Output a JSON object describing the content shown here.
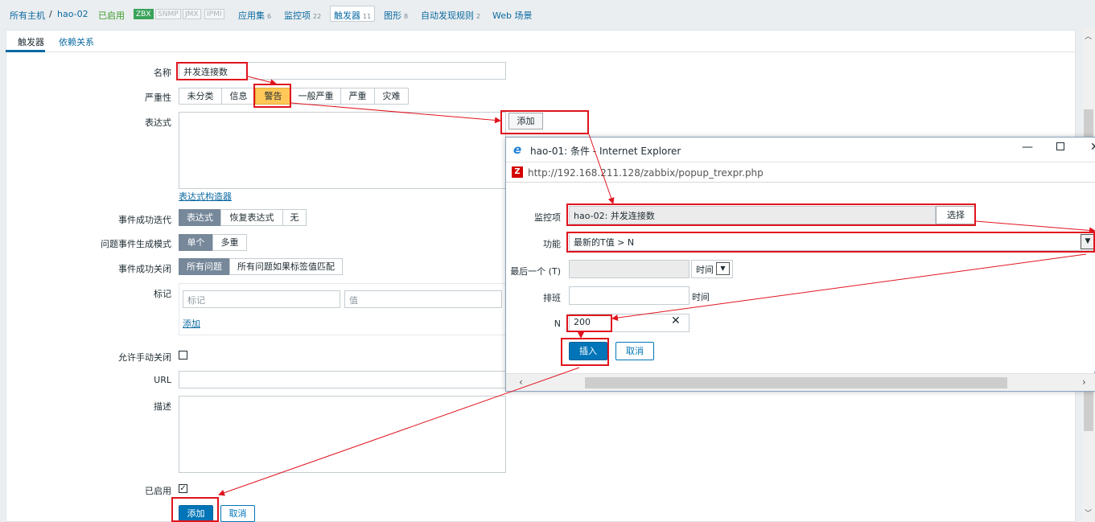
{
  "nav": {
    "all_hosts": "所有主机",
    "sep": "/",
    "host": "hao-02",
    "enabled": "已启用",
    "tags": [
      "ZBX",
      "SNMP",
      "JMX",
      "IPMI"
    ],
    "items": [
      {
        "label": "应用集",
        "count": "6"
      },
      {
        "label": "监控项",
        "count": "22"
      },
      {
        "label": "触发器",
        "count": "11"
      },
      {
        "label": "图形",
        "count": "8"
      },
      {
        "label": "自动发现规则",
        "count": "2"
      },
      {
        "label": "Web 场景",
        "count": ""
      }
    ]
  },
  "subtabs": [
    "触发器",
    "依赖关系"
  ],
  "form": {
    "name_label": "名称",
    "name_value": "并发连接数",
    "severity_label": "严重性",
    "severities": [
      "未分类",
      "信息",
      "警告",
      "一般严重",
      "严重",
      "灾难"
    ],
    "expression_label": "表达式",
    "add_button": "添加",
    "expr_builder": "表达式构造器",
    "ok_event_label": "事件成功迭代",
    "ok_event_options": [
      "表达式",
      "恢复表达式",
      "无"
    ],
    "problem_mode_label": "问题事件生成模式",
    "problem_mode_options": [
      "单个",
      "多重"
    ],
    "ok_close_label": "事件成功关闭",
    "ok_close_options": [
      "所有问题",
      "所有问题如果标签值匹配"
    ],
    "tags_label": "标记",
    "tag_placeholder": "标记",
    "value_placeholder": "值",
    "tag_add": "添加",
    "manual_close_label": "允许手动关闭",
    "url_label": "URL",
    "desc_label": "描述",
    "enabled_label": "已启用",
    "submit": "添加",
    "cancel": "取消"
  },
  "popup": {
    "title": "hao-01: 条件 - Internet Explorer",
    "address": "http://192.168.211.128/zabbix/popup_trexpr.php",
    "item_label": "监控项",
    "item_value": "hao-02: 并发连接数",
    "select_button": "选择",
    "function_label": "功能",
    "function_value": "最新的T值 > N",
    "last_label": "最后一个 (T)",
    "time_unit": "时间",
    "shift_label": "排班",
    "shift_unit": "时间",
    "n_label": "N",
    "n_value": "200",
    "insert": "插入",
    "cancel": "取消"
  },
  "colors": {
    "accent": "#0275b8",
    "annotation": "#e0141e",
    "warning": "#ffc859"
  }
}
